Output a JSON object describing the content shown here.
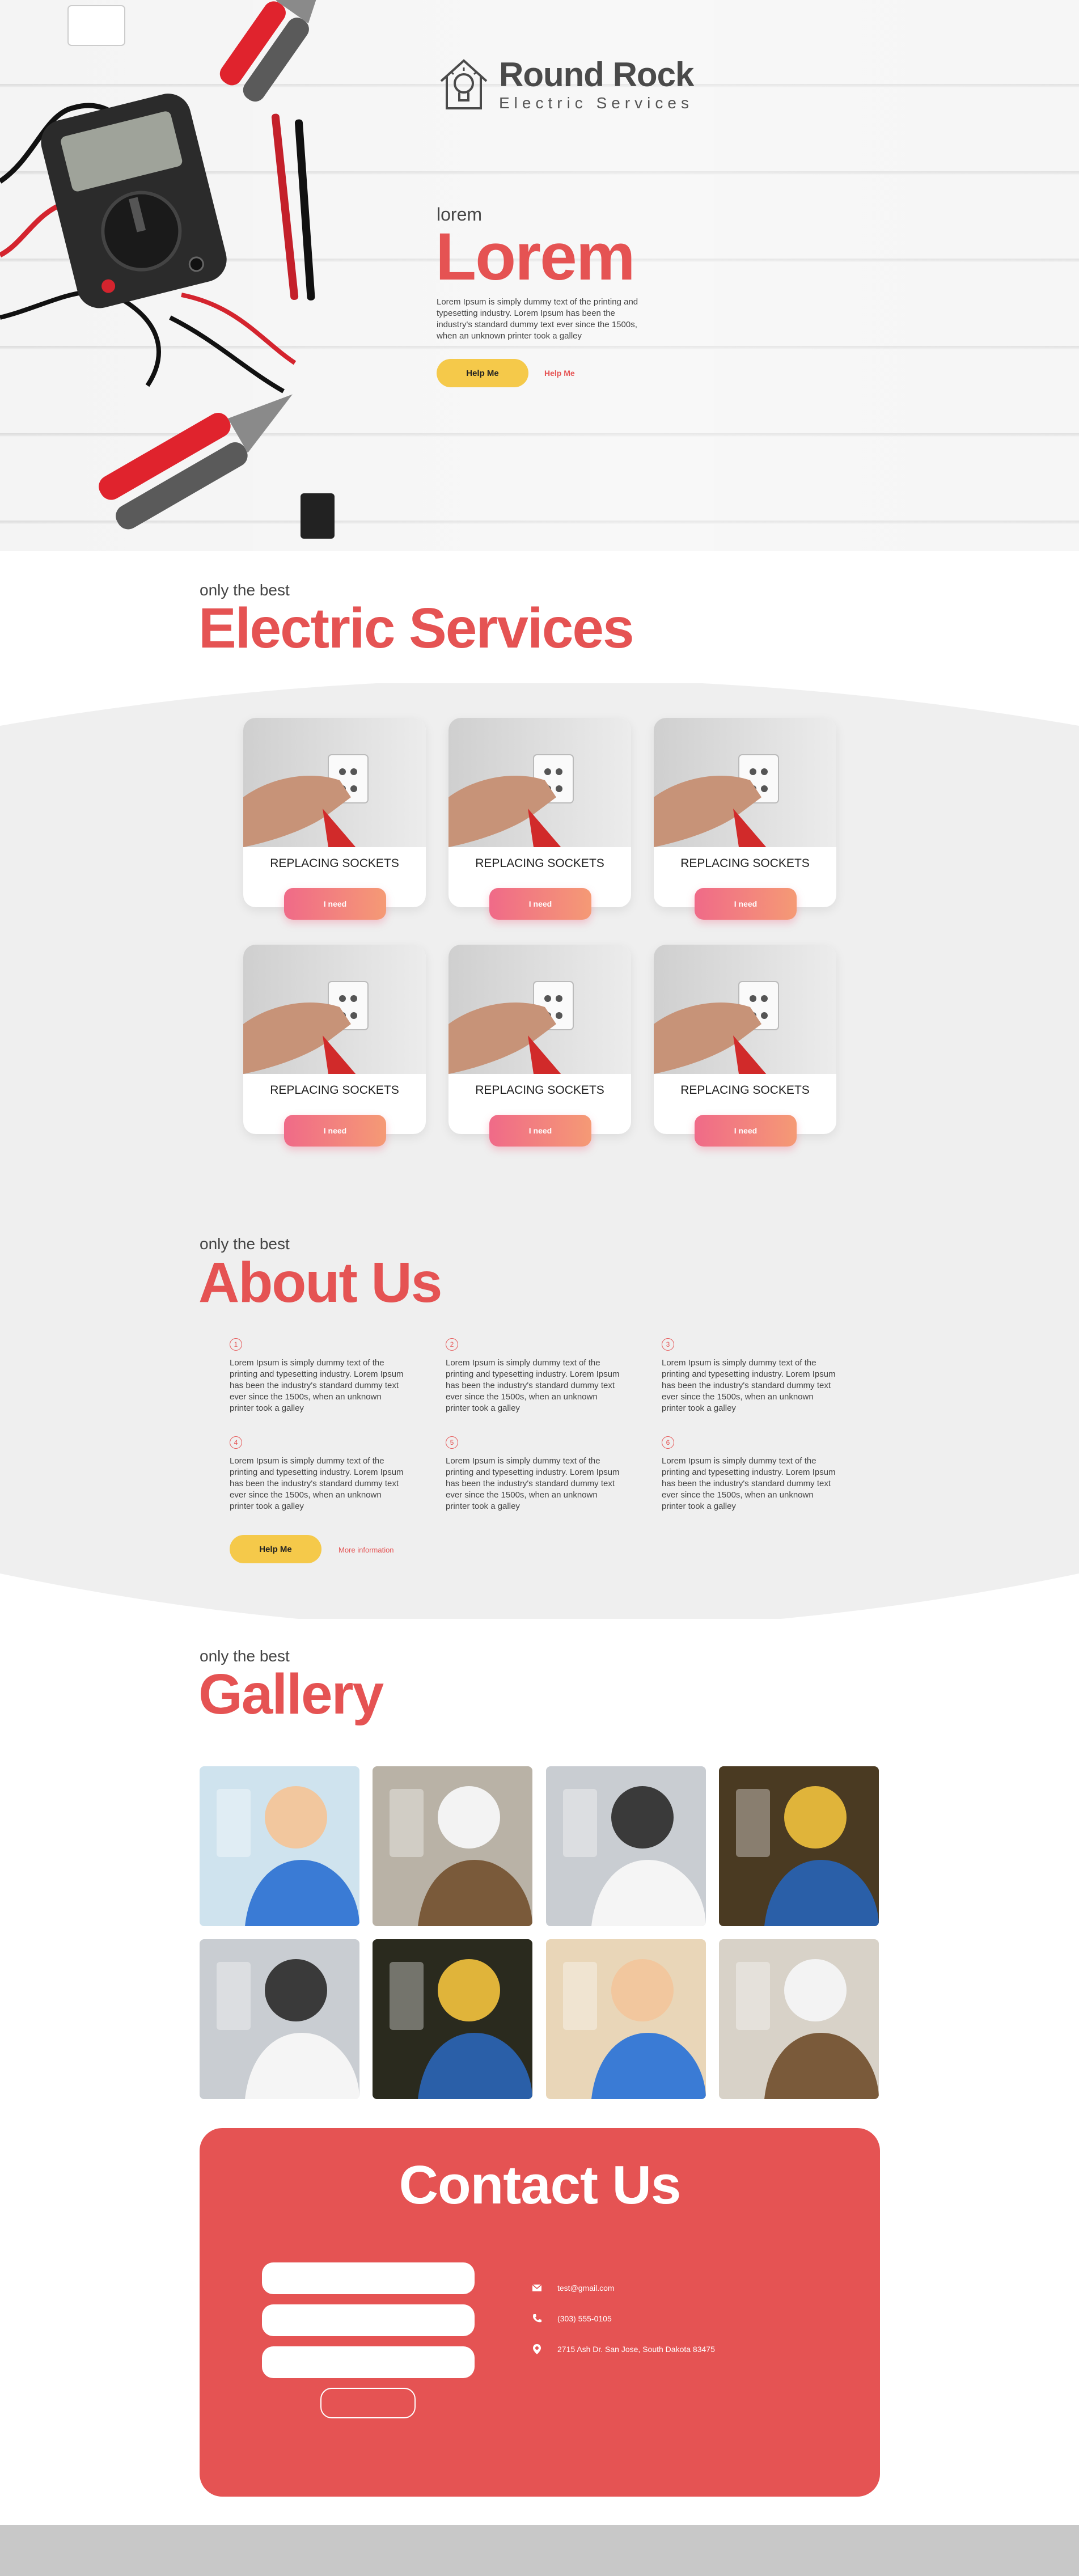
{
  "hero": {
    "logo_name": "Round Rock",
    "logo_sub": "Electric Services",
    "kicker": "lorem",
    "title": "Lorem",
    "text": "Lorem Ipsum is simply dummy text of the printing and typesetting industry. Lorem Ipsum has been the industry's standard dummy text ever since the 1500s, when an unknown printer took a galley",
    "primary_button": "Help Me",
    "secondary_link": "Help Me"
  },
  "services": {
    "kicker": "only the best",
    "title": "Electric Services",
    "cards": [
      {
        "title": "REPLACING SOCKETS",
        "button": "I need"
      },
      {
        "title": "REPLACING SOCKETS",
        "button": "I need"
      },
      {
        "title": "REPLACING SOCKETS",
        "button": "I need"
      },
      {
        "title": "REPLACING SOCKETS",
        "button": "I need"
      },
      {
        "title": "REPLACING SOCKETS",
        "button": "I need"
      },
      {
        "title": "REPLACING SOCKETS",
        "button": "I need"
      }
    ]
  },
  "about": {
    "kicker": "only the best",
    "title": "About Us",
    "items": [
      {
        "num": "1",
        "text": "Lorem Ipsum is simply dummy text of the printing and typesetting industry. Lorem Ipsum has been the industry's standard dummy text ever since the 1500s, when an unknown printer took a galley"
      },
      {
        "num": "2",
        "text": "Lorem Ipsum is simply dummy text of the printing and typesetting industry. Lorem Ipsum has been the industry's standard dummy text ever since the 1500s, when an unknown printer took a galley"
      },
      {
        "num": "3",
        "text": "Lorem Ipsum is simply dummy text of the printing and typesetting industry. Lorem Ipsum has been the industry's standard dummy text ever since the 1500s, when an unknown printer took a galley"
      },
      {
        "num": "4",
        "text": "Lorem Ipsum is simply dummy text of the printing and typesetting industry. Lorem Ipsum has been the industry's standard dummy text ever since the 1500s, when an unknown printer took a galley"
      },
      {
        "num": "5",
        "text": "Lorem Ipsum is simply dummy text of the printing and typesetting industry. Lorem Ipsum has been the industry's standard dummy text ever since the 1500s, when an unknown printer took a galley"
      },
      {
        "num": "6",
        "text": "Lorem Ipsum is simply dummy text of the printing and typesetting industry. Lorem Ipsum has been the industry's standard dummy text ever since the 1500s, when an unknown printer took a galley"
      }
    ],
    "primary_button": "Help Me",
    "secondary_link": "More information"
  },
  "gallery": {
    "kicker": "only the best",
    "title": "Gallery"
  },
  "contact": {
    "title": "Contact Us",
    "email": "test@gmail.com",
    "phone": "(303) 555-0105",
    "address": "2715 Ash Dr. San Jose, South Dakota 83475"
  },
  "colors": {
    "accent": "#e55353",
    "button_yellow": "#f5c94a",
    "band_gray": "#efefef",
    "footer_gray": "#c8c8c8"
  },
  "icons": [
    "lightbulb-house-logo-icon",
    "mail-icon",
    "phone-icon",
    "location-pin-icon"
  ]
}
